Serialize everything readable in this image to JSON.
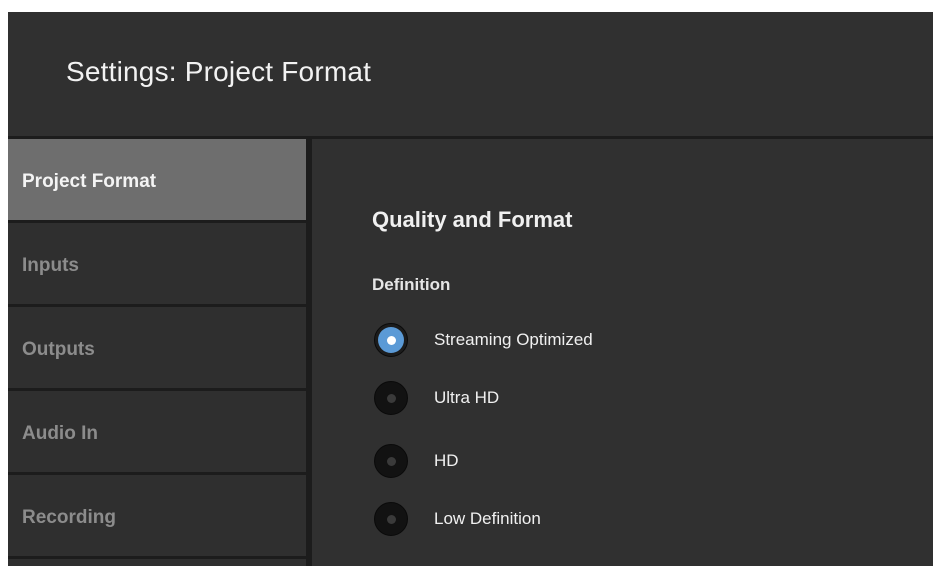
{
  "window": {
    "title": "Settings: Project Format"
  },
  "sidebar": {
    "items": [
      {
        "label": "Project Format"
      },
      {
        "label": "Inputs"
      },
      {
        "label": "Outputs"
      },
      {
        "label": "Audio In"
      },
      {
        "label": "Recording"
      }
    ]
  },
  "main": {
    "section_title": "Quality and Format",
    "definition": {
      "label": "Definition",
      "options": [
        {
          "label": "Streaming Optimized",
          "selected": true
        },
        {
          "label": "Ultra HD",
          "selected": false
        },
        {
          "label": "HD",
          "selected": false
        },
        {
          "label": "Low Definition",
          "selected": false
        }
      ]
    }
  },
  "colors": {
    "accent": "#5b9ad6",
    "active_item": "#6e6e6e",
    "panel": "#303030"
  }
}
